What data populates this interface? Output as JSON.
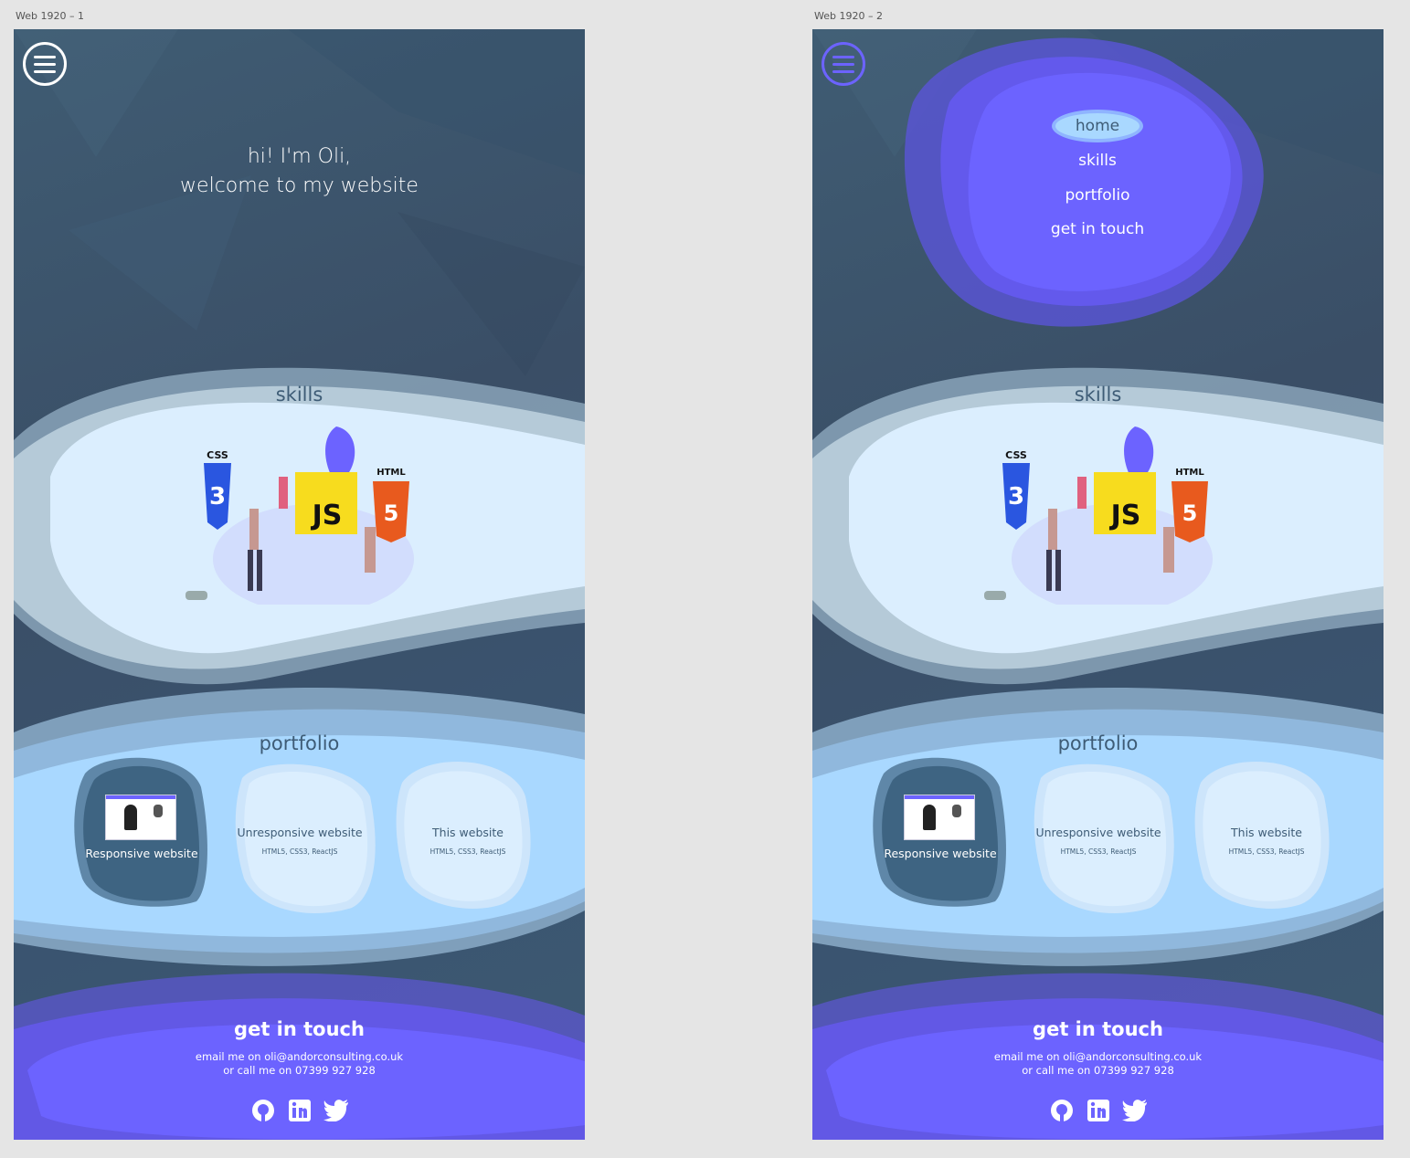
{
  "artboards": [
    {
      "label": "Web 1920 – 1"
    },
    {
      "label": "Web 1920 – 2"
    }
  ],
  "hero": {
    "line1": "hi! I'm Oli,",
    "line2": "welcome to my website"
  },
  "skills": {
    "title": "skills",
    "badges": {
      "css": "CSS",
      "js": "JS",
      "html": "HTML"
    }
  },
  "portfolio": {
    "title": "portfolio",
    "cards": [
      {
        "label": "Responsive website",
        "sub": ""
      },
      {
        "label": "Unresponsive website",
        "sub": "HTML5, CSS3, ReactJS"
      },
      {
        "label": "This website",
        "sub": "HTML5, CSS3, ReactJS"
      }
    ]
  },
  "contact": {
    "title": "get in touch",
    "email_line": "email me on oli@andorconsulting.co.uk",
    "phone_line": "or call me on 07399 927 928",
    "icons": [
      "github-icon",
      "linkedin-icon",
      "twitter-icon"
    ]
  },
  "menu": {
    "items": [
      "home",
      "skills",
      "portfolio",
      "get in touch"
    ]
  },
  "colors": {
    "accent": "#6c63ff",
    "light_blue": "#dbeefe",
    "mid_blue": "#a9d8ff",
    "text_dark": "#3e5c76"
  }
}
